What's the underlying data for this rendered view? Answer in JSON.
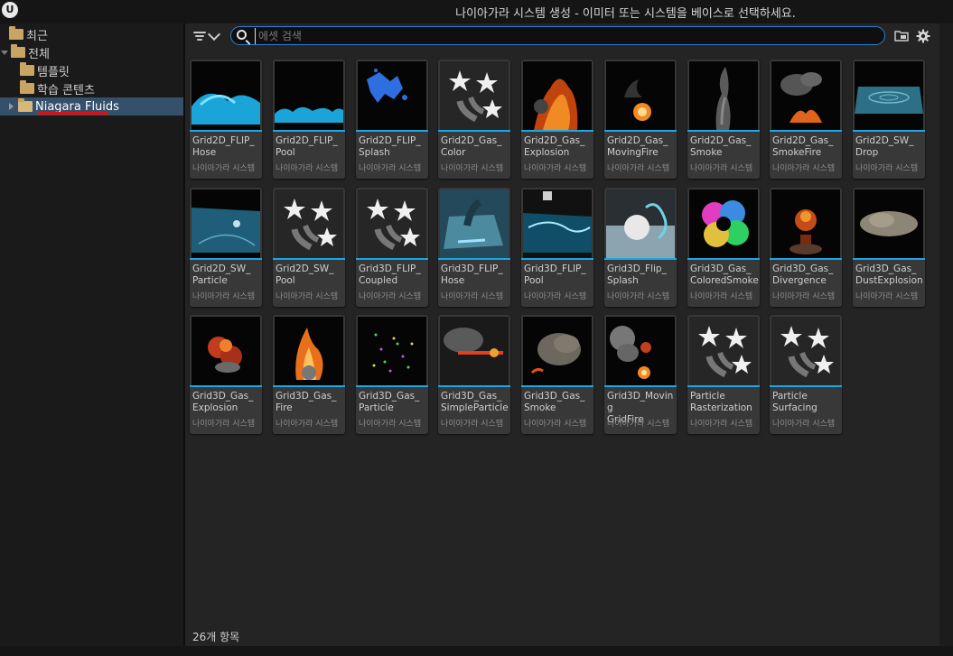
{
  "window": {
    "title": "나이아가라 시스템 생성 - 이미터 또는 시스템을 베이스로 선택하세요.",
    "logo": "U"
  },
  "sidebar": {
    "items": [
      {
        "label": "최근",
        "expand": "none"
      },
      {
        "label": "전체",
        "expand": "down"
      },
      {
        "label": "템플릿",
        "expand": "none"
      },
      {
        "label": "학습 콘텐츠",
        "expand": "none"
      },
      {
        "label": "Niagara Fluids",
        "expand": "right",
        "selected": true
      }
    ],
    "highlight_color": "#35506b",
    "annotation_color": "#e01010"
  },
  "toolbar": {
    "search_placeholder": "에셋 검색",
    "filter_icon": "filter-icon",
    "folder_icon": "folder-icon",
    "settings_icon": "gear-icon"
  },
  "assets": [
    {
      "name": "Grid2D_FLIP_\nHose",
      "type": "나이아가라 시스템",
      "thumb": "water-hose"
    },
    {
      "name": "Grid2D_FLIP_\nPool",
      "type": "나이아가라 시스템",
      "thumb": "water-pool"
    },
    {
      "name": "Grid2D_FLIP_\nSplash",
      "type": "나이아가라 시스템",
      "thumb": "water-splash"
    },
    {
      "name": "Grid2D_Gas_\nColor",
      "type": "나이아가라 시스템",
      "thumb": "default-stars"
    },
    {
      "name": "Grid2D_Gas_\nExplosion",
      "type": "나이아가라 시스템",
      "thumb": "fire-explosion"
    },
    {
      "name": "Grid2D_Gas_\nMovingFire",
      "type": "나이아가라 시스템",
      "thumb": "moving-fire"
    },
    {
      "name": "Grid2D_Gas_\nSmoke",
      "type": "나이아가라 시스템",
      "thumb": "smoke-column"
    },
    {
      "name": "Grid2D_Gas_\nSmokeFire",
      "type": "나이아가라 시스템",
      "thumb": "smoke-fire"
    },
    {
      "name": "Grid2D_SW_\nDrop",
      "type": "나이아가라 시스템",
      "thumb": "shallow-drop"
    },
    {
      "name": "Grid2D_SW_\nParticle",
      "type": "나이아가라 시스템",
      "thumb": "shallow-particle"
    },
    {
      "name": "Grid2D_SW_\nPool",
      "type": "나이아가라 시스템",
      "thumb": "default-stars"
    },
    {
      "name": "Grid3D_FLIP_\nCoupled",
      "type": "나이아가라 시스템",
      "thumb": "default-stars"
    },
    {
      "name": "Grid3D_FLIP_\nHose",
      "type": "나이아가라 시스템",
      "thumb": "3d-hose"
    },
    {
      "name": "Grid3D_FLIP_\nPool",
      "type": "나이아가라 시스템",
      "thumb": "3d-pool"
    },
    {
      "name": "Grid3D_Flip_\nSplash",
      "type": "나이아가라 시스템",
      "thumb": "3d-splash"
    },
    {
      "name": "Grid3D_Gas_\nColoredSmoke",
      "type": "나이아가라 시스템",
      "thumb": "colored-smoke"
    },
    {
      "name": "Grid3D_Gas_\nDivergence",
      "type": "나이아가라 시스템",
      "thumb": "divergence"
    },
    {
      "name": "Grid3D_Gas_\nDustExplosion",
      "type": "나이아가라 시스템",
      "thumb": "dust-explosion"
    },
    {
      "name": "Grid3D_Gas_\nExplosion",
      "type": "나이아가라 시스템",
      "thumb": "3d-explosion"
    },
    {
      "name": "Grid3D_Gas_\nFire",
      "type": "나이아가라 시스템",
      "thumb": "3d-fire"
    },
    {
      "name": "Grid3D_Gas_\nParticle",
      "type": "나이아가라 시스템",
      "thumb": "gas-particle"
    },
    {
      "name": "Grid3D_Gas_\nSimpleParticle",
      "type": "나이아가라 시스템",
      "thumb": "simple-particle"
    },
    {
      "name": "Grid3D_Gas_\nSmoke",
      "type": "나이아가라 시스템",
      "thumb": "3d-smoke"
    },
    {
      "name": "Grid3D_Moving\nGridFire",
      "type": "나이아가라 시스템",
      "thumb": "moving-grid-fire"
    },
    {
      "name": "Particle\nRasterization",
      "type": "나이아가라 시스템",
      "thumb": "default-stars"
    },
    {
      "name": "Particle\nSurfacing",
      "type": "나이아가라 시스템",
      "thumb": "default-stars"
    }
  ],
  "status": {
    "count_label": "26개 항목"
  },
  "colors": {
    "accent": "#2b7fd6",
    "tile_bar": "#19a7e6"
  }
}
